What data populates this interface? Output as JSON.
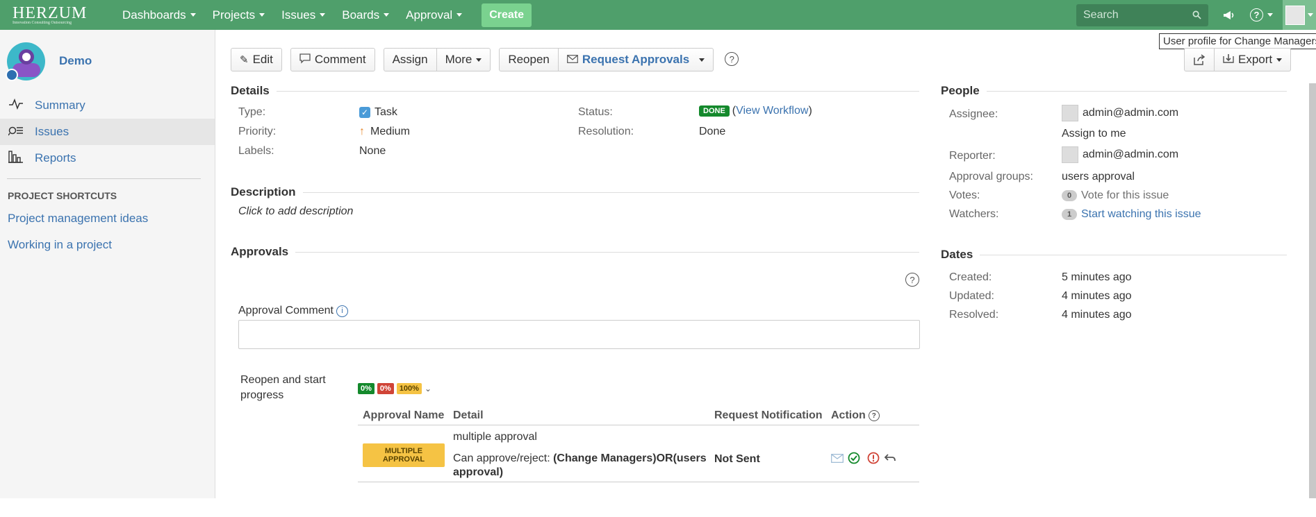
{
  "topbar": {
    "logo": "HERZUM",
    "logo_sub": "Innovation Consulting Outsourcing",
    "nav": [
      {
        "label": "Dashboards"
      },
      {
        "label": "Projects"
      },
      {
        "label": "Issues"
      },
      {
        "label": "Boards"
      },
      {
        "label": "Approval"
      }
    ],
    "create_label": "Create",
    "search_placeholder": "Search",
    "profile_tooltip": "User profile for Change Managers"
  },
  "sidebar": {
    "project_name": "Demo",
    "items": [
      {
        "label": "Summary",
        "icon": "summary-icon"
      },
      {
        "label": "Issues",
        "icon": "issues-icon"
      },
      {
        "label": "Reports",
        "icon": "reports-icon"
      }
    ],
    "shortcuts_heading": "PROJECT SHORTCUTS",
    "shortcuts": [
      {
        "label": "Project management ideas"
      },
      {
        "label": "Working in a project"
      }
    ]
  },
  "toolbar": {
    "edit": "Edit",
    "comment": "Comment",
    "assign": "Assign",
    "more": "More",
    "reopen": "Reopen",
    "request_approvals": "Request Approvals",
    "export": "Export"
  },
  "details": {
    "title": "Details",
    "type_label": "Type:",
    "type_value": "Task",
    "priority_label": "Priority:",
    "priority_value": "Medium",
    "labels_label": "Labels:",
    "labels_value": "None",
    "status_label": "Status:",
    "status_value": "DONE",
    "view_workflow": "View Workflow",
    "resolution_label": "Resolution:",
    "resolution_value": "Done"
  },
  "description": {
    "title": "Description",
    "placeholder": "Click to add description"
  },
  "approvals": {
    "title": "Approvals",
    "comment_label": "Approval Comment",
    "transition": "Reopen and start progress",
    "pct_green": "0%",
    "pct_red": "0%",
    "pct_yellow": "100%",
    "headers": [
      "Approval Name",
      "Detail",
      "Request Notification",
      "Action"
    ],
    "row": {
      "name": "MULTIPLE APPROVAL",
      "detail_title": "multiple approval",
      "detail_prefix": "Can approve/reject:",
      "detail_rule": "(Change Managers)OR(users approval)",
      "notification": "Not Sent"
    }
  },
  "people": {
    "title": "People",
    "assignee_label": "Assignee:",
    "assignee_value": "admin@admin.com",
    "assign_to_me": "Assign to me",
    "reporter_label": "Reporter:",
    "reporter_value": "admin@admin.com",
    "groups_label": "Approval groups:",
    "groups_value": "users approval",
    "votes_label": "Votes:",
    "votes_count": "0",
    "votes_link": "Vote for this issue",
    "watchers_label": "Watchers:",
    "watchers_count": "1",
    "watchers_link": "Start watching this issue"
  },
  "dates": {
    "title": "Dates",
    "created_label": "Created:",
    "created_value": "5 minutes ago",
    "updated_label": "Updated:",
    "updated_value": "4 minutes ago",
    "resolved_label": "Resolved:",
    "resolved_value": "4 minutes ago"
  }
}
